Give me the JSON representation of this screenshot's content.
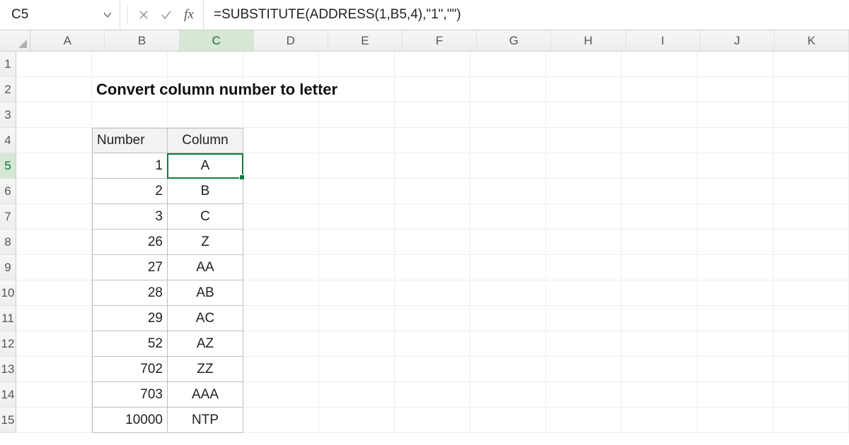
{
  "name_box": {
    "value": "C5"
  },
  "formula_bar": {
    "fx_label": "fx",
    "formula": "=SUBSTITUTE(ADDRESS(1,B5,4),\"1\",\"\")"
  },
  "columns": [
    "A",
    "B",
    "C",
    "D",
    "E",
    "F",
    "G",
    "H",
    "I",
    "J",
    "K"
  ],
  "rows": [
    "1",
    "2",
    "3",
    "4",
    "5",
    "6",
    "7",
    "8",
    "9",
    "10",
    "11",
    "12",
    "13",
    "14",
    "15"
  ],
  "selected_col_index": 2,
  "selected_row_index": 4,
  "heading": "Convert column number to letter",
  "table": {
    "header": {
      "number": "Number",
      "column": "Column"
    },
    "rows": [
      {
        "n": "1",
        "c": "A"
      },
      {
        "n": "2",
        "c": "B"
      },
      {
        "n": "3",
        "c": "C"
      },
      {
        "n": "26",
        "c": "Z"
      },
      {
        "n": "27",
        "c": "AA"
      },
      {
        "n": "28",
        "c": "AB"
      },
      {
        "n": "29",
        "c": "AC"
      },
      {
        "n": "52",
        "c": "AZ"
      },
      {
        "n": "702",
        "c": "ZZ"
      },
      {
        "n": "703",
        "c": "AAA"
      },
      {
        "n": "10000",
        "c": "NTP"
      }
    ]
  }
}
